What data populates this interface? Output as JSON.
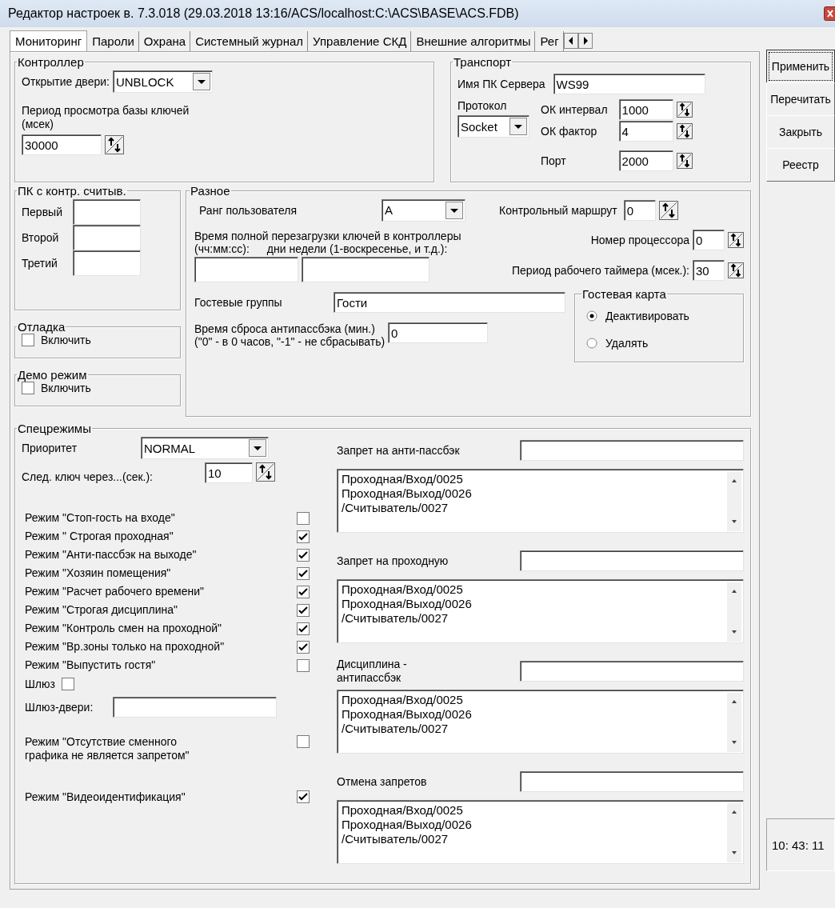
{
  "window": {
    "title": "Редактор настроек в. 7.3.018 (29.03.2018 13:16/ACS/localhost:C:\\ACS\\BASE\\ACS.FDB)"
  },
  "tabs": [
    {
      "label": "Мониторинг",
      "selected": true
    },
    {
      "label": "Пароли",
      "selected": false
    },
    {
      "label": "Охрана",
      "selected": false
    },
    {
      "label": "Системный журнал",
      "selected": false
    },
    {
      "label": "Управление СКД",
      "selected": false
    },
    {
      "label": "Внешние алгоритмы",
      "selected": false
    },
    {
      "label": "Рег",
      "selected": false
    }
  ],
  "controller": {
    "title": "Контроллер",
    "door_label": "Открытие двери:",
    "door_value": "UNBLOCK",
    "period_label": "Период просмотра базы ключей\n(мсек)",
    "period_value": "30000"
  },
  "transport": {
    "title": "Транспорт",
    "server_label": "Имя ПК Сервера",
    "server_value": "WS99",
    "protocol_label": "Протокол",
    "protocol_value": "Socket",
    "ok_interval_label": "ОК интервал",
    "ok_interval_value": "1000",
    "ok_factor_label": "ОК фактор",
    "ok_factor_value": "4",
    "port_label": "Порт",
    "port_value": "2000"
  },
  "readers": {
    "title": "ПК с контр. считыв.",
    "fields": [
      {
        "label": "Первый"
      },
      {
        "label": "Второй"
      },
      {
        "label": "Третий"
      }
    ]
  },
  "debug": {
    "title": "Отладка",
    "label": "Включить",
    "checked": false
  },
  "demo": {
    "title": "Демо режим",
    "label": "Включить",
    "checked": false
  },
  "misc": {
    "title": "Разное",
    "rank_label": "Ранг пользователя",
    "rank_value": "A",
    "route_label": "Контрольный маршрут",
    "route_value": "0",
    "reload_label": "Время полной перезагрузки ключей в контроллеры",
    "reload_time_label": "(чч:мм:сс):",
    "reload_days_label": "дни недели (1-воскресенье, и т.д.):",
    "cpu_label": "Номер процессора",
    "cpu_value": "0",
    "timer_label": "Период рабочего таймера (мсек.):",
    "timer_value": "30",
    "guest_groups_label": "Гостевые группы",
    "guest_groups_value": "Гости",
    "reset_label": "Время сброса антипассбэка (мин.)\n(\"0\" - в 0 часов, \"-1\" - не сбрасывать)",
    "reset_value": "0",
    "guest_card": {
      "title": "Гостевая карта",
      "options": [
        {
          "label": "Деактивировать",
          "selected": true
        },
        {
          "label": "Удалять",
          "selected": false
        }
      ]
    }
  },
  "special": {
    "title": "Спецрежимы",
    "priority_label": "Приоритет",
    "priority_value": "NORMAL",
    "next_key_label": "След. ключ через...(сек.):",
    "next_key_value": "10",
    "modes": [
      {
        "label": "Режим \"Стоп-гость на входе\"",
        "checked": false
      },
      {
        "label": "Режим \" Строгая проходная\"",
        "checked": true
      },
      {
        "label": "Режим \"Анти-пассбэк на выходе\"",
        "checked": true
      },
      {
        "label": "Режим \"Хозяин помещения\"",
        "checked": true
      },
      {
        "label": "Режим \"Расчет рабочего времени\"",
        "checked": true
      },
      {
        "label": "Режим \"Строгая дисциплина\"",
        "checked": true
      },
      {
        "label": "Режим \"Контроль смен на проходной\"",
        "checked": true
      },
      {
        "label": "Режим \"Вр.зоны только на проходной\"",
        "checked": true
      },
      {
        "label": "Режим \"Выпустить гостя\"",
        "checked": false
      }
    ],
    "gateway": {
      "label": "Шлюз",
      "checked": false
    },
    "gateway_doors_label": "Шлюз-двери:",
    "extra_modes": [
      {
        "label": "Режим \"Отсутствие сменного\nграфика не является запретом\"",
        "checked": false
      },
      {
        "label": "Режим \"Видеоидентификация\"",
        "checked": true
      }
    ],
    "lists": [
      {
        "label": "Запрет на анти-пассбэк",
        "items": [
          "Проходная/Вход/0025",
          "Проходная/Выход/0026",
          "/Считыватель/0027"
        ]
      },
      {
        "label": "Запрет на проходную",
        "items": [
          "Проходная/Вход/0025",
          "Проходная/Выход/0026",
          "/Считыватель/0027"
        ]
      },
      {
        "label": "Дисциплина -\nантипассбэк",
        "items": [
          "Проходная/Вход/0025",
          "Проходная/Выход/0026",
          "/Считыватель/0027"
        ]
      },
      {
        "label": "Отмена запретов",
        "items": [
          "Проходная/Вход/0025",
          "Проходная/Выход/0026",
          "/Считыватель/0027"
        ]
      }
    ]
  },
  "buttons": [
    {
      "label": "Применить",
      "focused": true
    },
    {
      "label": "Перечитать",
      "focused": false
    },
    {
      "label": "Закрыть",
      "focused": false
    },
    {
      "label": "Реестр",
      "focused": false
    }
  ],
  "clock": "10: 43: 11"
}
